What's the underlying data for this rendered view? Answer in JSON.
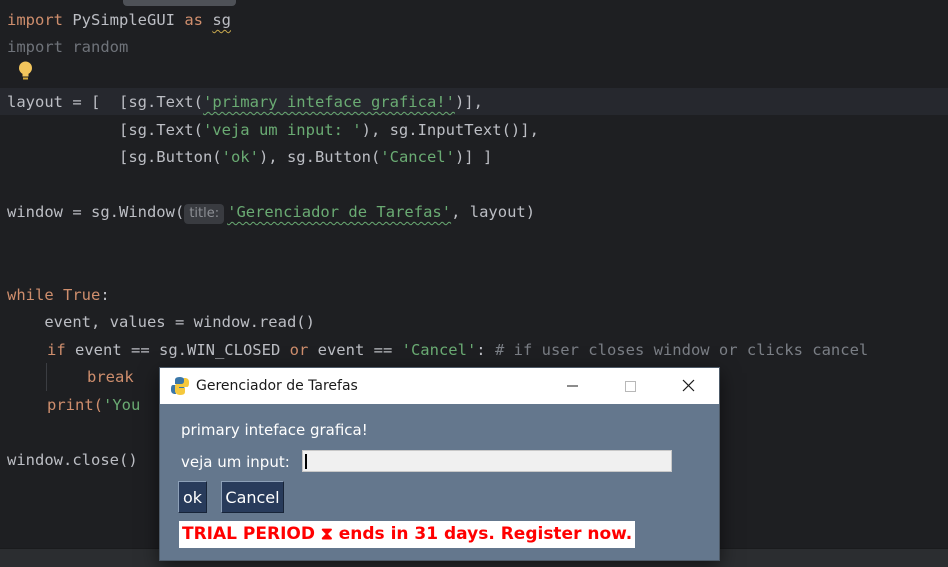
{
  "editor": {
    "line1": {
      "kw": "import",
      "rest": " PySimpleGUI ",
      "kw2": "as",
      "alias": "sg"
    },
    "line2": "import random",
    "line4": {
      "a": "layout = [ ",
      "b": " [sg.Text(",
      "str": "'primary inteface grafica!'",
      "c": ")],"
    },
    "line5": {
      "a": "            [sg.Text(",
      "str": "'veja um input: '",
      "c": "), sg.InputText()],"
    },
    "line6": {
      "a": "            [sg.Button(",
      "s1": "'ok'",
      "b": "), sg.Button(",
      "s2": "'Cancel'",
      "c": ")]",
      "d": " ]"
    },
    "line8": {
      "a": "window = sg.Window(",
      "hint": "title:",
      "str": "'Gerenciador de Tarefas'",
      "c": ", layout)"
    },
    "line11": {
      "kw": "while",
      "sp": " ",
      "kw2": "True",
      "c": ":"
    },
    "line12": "    event, values = window.read()",
    "line13": {
      "kw": "if",
      "a": " event == sg.WIN_CLOSED ",
      "kw2": "or",
      "b": " event == ",
      "str": "'Cancel'",
      "c": ":",
      "cmt": " # if user closes window or clicks cancel"
    },
    "line14": {
      "kw": "break"
    },
    "line15": {
      "a": "print(",
      "str": "'You"
    },
    "line17": "window.close()"
  },
  "gui": {
    "title": "Gerenciador de Tarefas",
    "text1": "primary inteface grafica!",
    "label": "veja um input:",
    "input_value": "",
    "ok": "ok",
    "cancel": "Cancel",
    "trial": "TRIAL PERIOD ⧗ ends in 31 days. Register now."
  },
  "colors": {
    "editor_bg": "#1e1f22",
    "keyword": "#cf8e6d",
    "string": "#6aab73",
    "window_bg": "#64778d",
    "button_bg": "#283b5b",
    "trial_red": "#ff0000"
  }
}
